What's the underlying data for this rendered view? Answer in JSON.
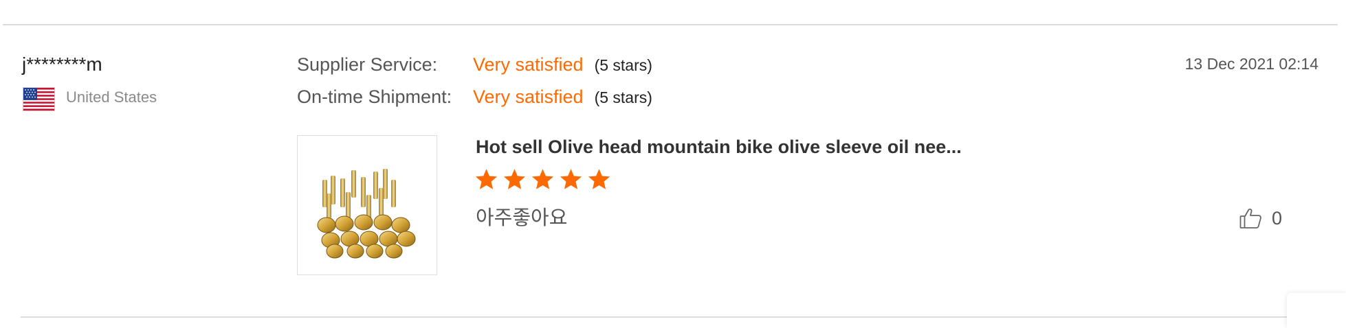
{
  "review": {
    "user_name": "j********m",
    "country": "United States",
    "flag_icon": "us-flag-icon",
    "timestamp": "13 Dec 2021 02:14",
    "ratings": [
      {
        "label": "Supplier Service:",
        "value": "Very satisfied",
        "stars_text": "(5 stars)"
      },
      {
        "label": "On-time Shipment:",
        "value": "Very satisfied",
        "stars_text": "(5 stars)"
      }
    ],
    "product_title": "Hot sell Olive head mountain bike olive sleeve oil nee...",
    "product_rating": 5,
    "product_rating_max": 5,
    "review_text": "아주좋아요",
    "like_icon": "thumbs-up-icon",
    "like_count": "0"
  },
  "colors": {
    "accent": "#ff6a00",
    "text": "#333333",
    "muted": "#8a8a8a",
    "divider": "#dcdcdc"
  }
}
